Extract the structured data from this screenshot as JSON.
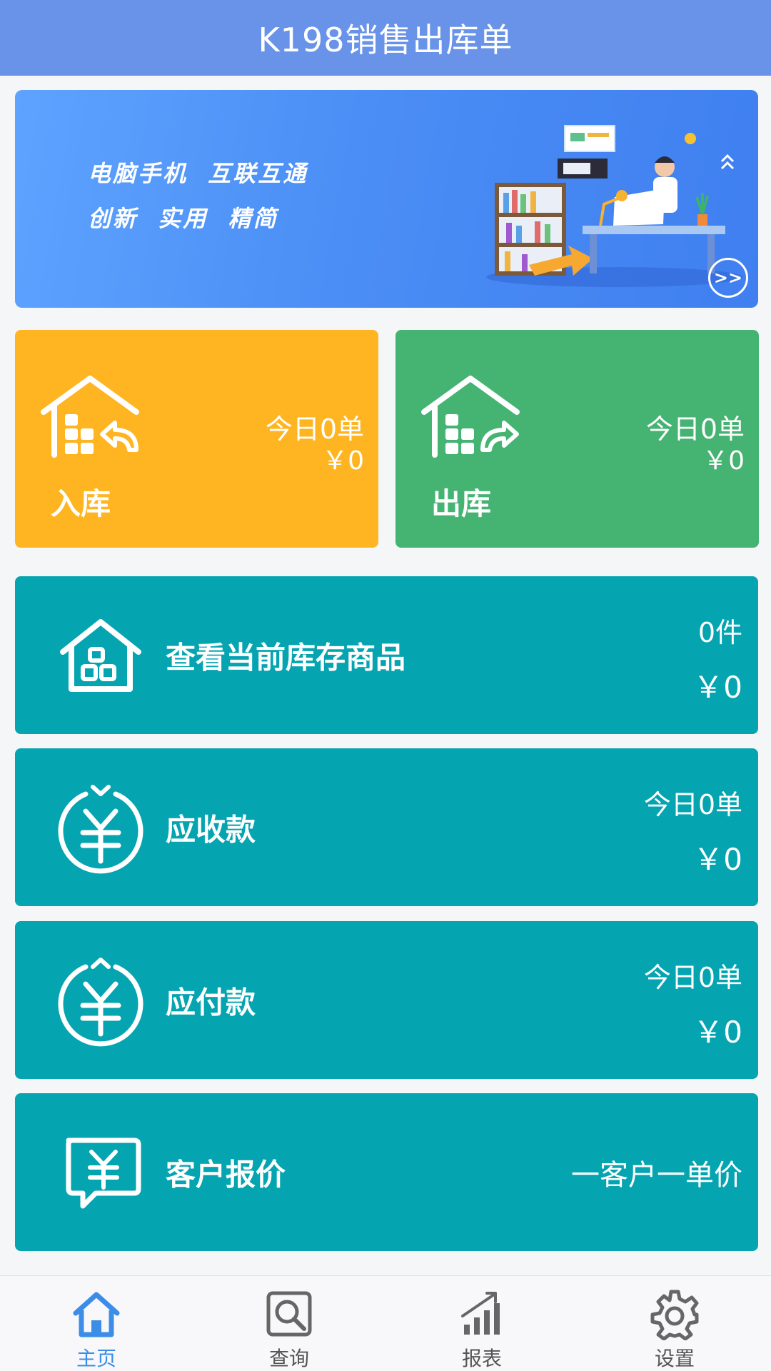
{
  "header": {
    "title": "K198销售出库单"
  },
  "banner": {
    "line1": "电脑手机  互联互通",
    "line2": "创新  实用  精简",
    "more_label": ">>"
  },
  "tiles": {
    "stock_in": {
      "label": "入库",
      "count": "今日0单",
      "amount": "￥0",
      "color": "#ffb522"
    },
    "stock_out": {
      "label": "出库",
      "count": "今日0单",
      "amount": "￥0",
      "color": "#45b372"
    }
  },
  "rows": {
    "inventory": {
      "label": "查看当前库存商品",
      "top": "0件",
      "bottom": "￥0"
    },
    "receivable": {
      "label": "应收款",
      "top": "今日0单",
      "bottom": "￥0"
    },
    "payable": {
      "label": "应付款",
      "top": "今日0单",
      "bottom": "￥0"
    },
    "quote": {
      "label": "客户报价",
      "right": "一客户一单价"
    }
  },
  "nav": [
    {
      "label": "主页",
      "icon": "home-icon",
      "active": true
    },
    {
      "label": "查询",
      "icon": "search-icon",
      "active": false
    },
    {
      "label": "报表",
      "icon": "chart-icon",
      "active": false
    },
    {
      "label": "设置",
      "icon": "gear-icon",
      "active": false
    }
  ],
  "colors": {
    "header": "#6893e8",
    "teal": "#04a4b1",
    "active_nav": "#3b8de8"
  }
}
